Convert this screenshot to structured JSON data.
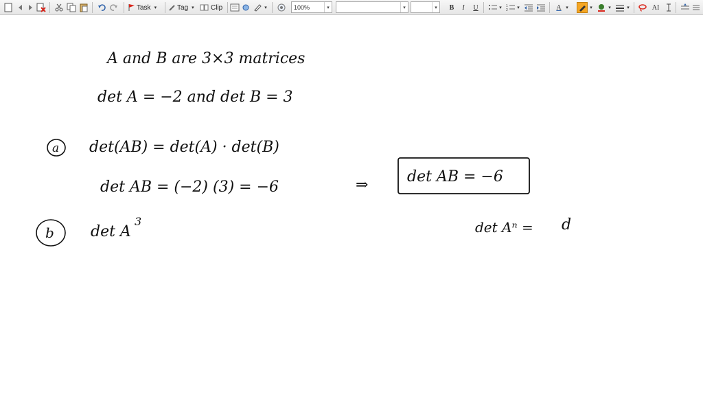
{
  "toolbar": {
    "task_label": "Task",
    "tag_label": "Tag",
    "clip_label": "Clip",
    "zoom_value": "100%",
    "font_value": "",
    "size_value": "",
    "bold_label": "B",
    "italic_label": "I",
    "underline_label": "U",
    "text_color_label": "A",
    "ai_label": "AI",
    "accent_highlight": "#f5a623",
    "accent_red": "#d9261c"
  },
  "note": {
    "line1": "A  and  B  are   3×3  matrices",
    "line2": "det A = −2    and    det B = 3",
    "part_a_marker": "a",
    "part_a_line1": "det(AB) =  det(A) · det(B)",
    "part_a_line2": "det AB  = (−2)  (3)  =  −6",
    "implies": "⇒",
    "boxed_answer": "det AB = −6",
    "part_b_marker": "b",
    "part_b_line1": "det A",
    "part_b_exponent": "3",
    "side_note": "det Aⁿ =",
    "side_note_tail": "d"
  }
}
